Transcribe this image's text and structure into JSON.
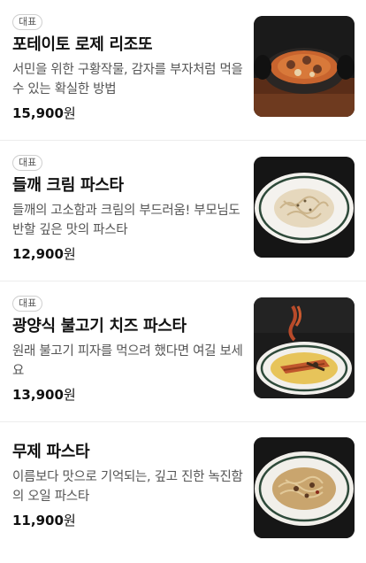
{
  "menu": {
    "items": [
      {
        "badge": "대표",
        "name": "포테이토 로제 리조또",
        "description": "서민을 위한 구황작물, 감자를 부자처럼 먹을 수 있는 확실한 방법",
        "price": "15,900",
        "currency": "원",
        "image_icon": "risotto-photo"
      },
      {
        "badge": "대표",
        "name": "들깨 크림 파스타",
        "description": "들깨의 고소함과 크림의 부드러움! 부모님도 반할 깊은 맛의 파스타",
        "price": "12,900",
        "currency": "원",
        "image_icon": "perilla-cream-pasta-photo"
      },
      {
        "badge": "대표",
        "name": "광양식 불고기 치즈 파스타",
        "description": "원래 불고기 피자를 먹으려 했다면 여길 보세요",
        "price": "13,900",
        "currency": "원",
        "image_icon": "bulgogi-cheese-pasta-photo"
      },
      {
        "badge": "",
        "name": "무제 파스타",
        "description": "이름보다 맛으로 기억되는, 깊고 진한 녹진함의 오일 파스타",
        "price": "11,900",
        "currency": "원",
        "image_icon": "oil-pasta-photo"
      }
    ]
  }
}
